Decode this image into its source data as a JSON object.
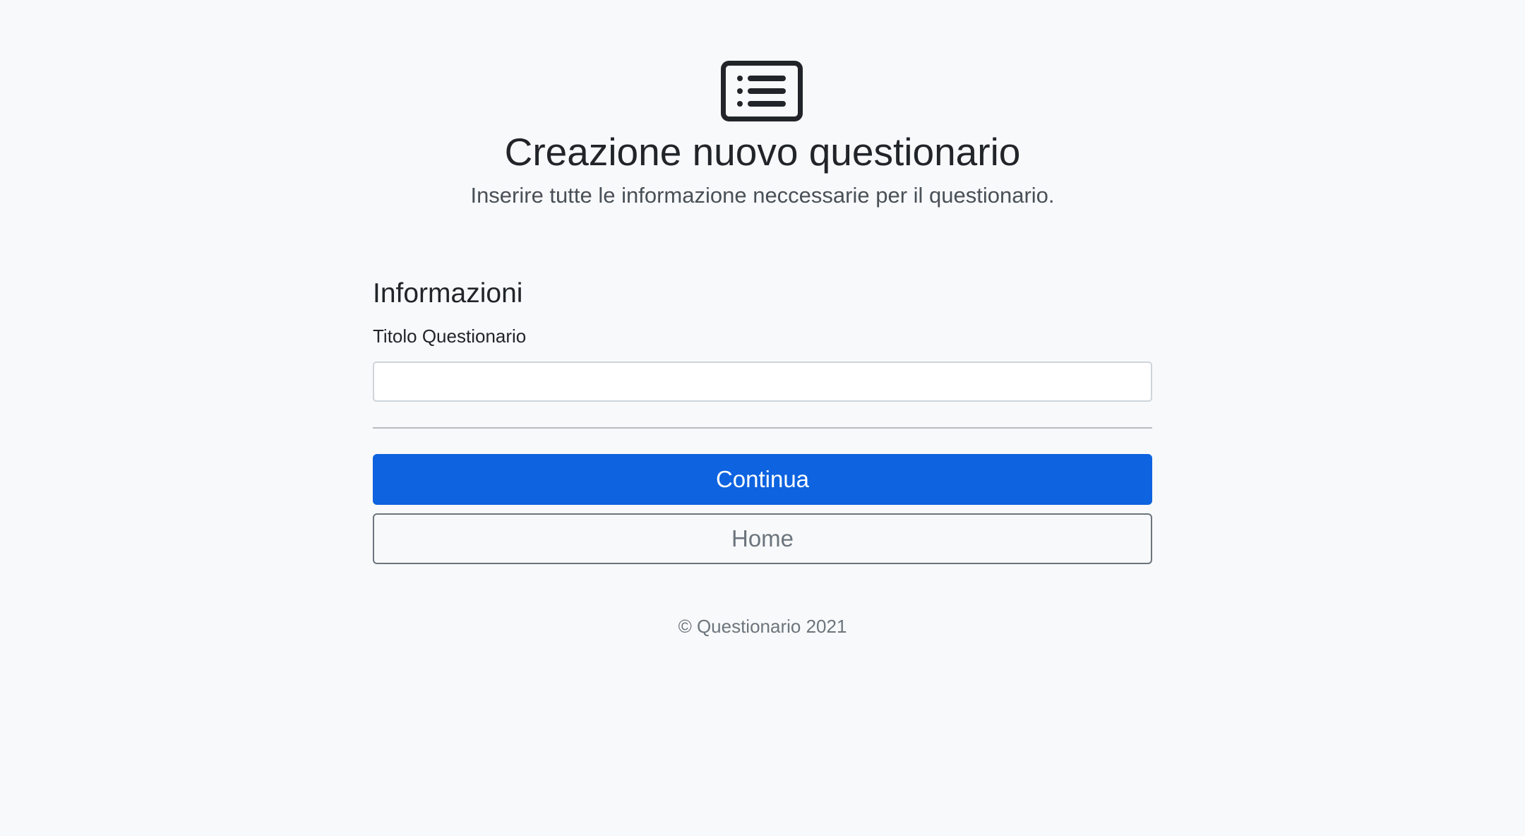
{
  "header": {
    "icon": "list-card-icon",
    "title": "Creazione nuovo questionario",
    "subtitle": "Inserire tutte le informazione neccessarie per il questionario."
  },
  "form": {
    "section_title": "Informazioni",
    "title_field": {
      "label": "Titolo Questionario",
      "value": "",
      "placeholder": ""
    },
    "continue_label": "Continua",
    "home_label": "Home"
  },
  "footer": {
    "copyright": "© Questionario 2021"
  },
  "colors": {
    "background": "#f8f9fa",
    "primary": "#0d63e0",
    "secondary": "#6c757d",
    "text": "#212529"
  }
}
